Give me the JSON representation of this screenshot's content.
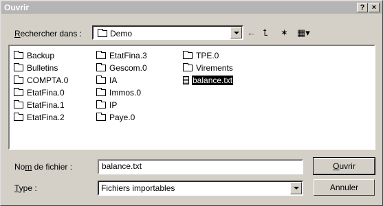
{
  "dialog": {
    "title": "Ouvrir",
    "help_label": "?",
    "close_label": "×"
  },
  "look_in": {
    "label_underlined": "R",
    "label_rest": "echercher dans :",
    "value": "Demo"
  },
  "toolbar": {
    "back_icon": "←",
    "up_icon": "⮤",
    "new_folder_icon": "✶",
    "view_icon": "▦▾"
  },
  "files": [
    {
      "name": "Backup",
      "type": "folder"
    },
    {
      "name": "Bulletins",
      "type": "folder"
    },
    {
      "name": "COMPTA.0",
      "type": "folder"
    },
    {
      "name": "EtatFina.0",
      "type": "folder"
    },
    {
      "name": "EtatFina.1",
      "type": "folder"
    },
    {
      "name": "EtatFina.2",
      "type": "folder"
    },
    {
      "name": "EtatFina.3",
      "type": "folder"
    },
    {
      "name": "Gescom.0",
      "type": "folder"
    },
    {
      "name": "IA",
      "type": "folder"
    },
    {
      "name": "Immos.0",
      "type": "folder"
    },
    {
      "name": "IP",
      "type": "folder"
    },
    {
      "name": "Paye.0",
      "type": "folder"
    },
    {
      "name": "TPE.0",
      "type": "folder"
    },
    {
      "name": "Virements",
      "type": "folder"
    },
    {
      "name": "balance.txt",
      "type": "file",
      "selected": true
    }
  ],
  "filename": {
    "label_pre": "No",
    "label_underlined": "m",
    "label_post": " de fichier :",
    "value": "balance.txt"
  },
  "filetype": {
    "label_underlined": "T",
    "label_rest": "ype :",
    "value": "Fichiers importables"
  },
  "buttons": {
    "open_underlined": "O",
    "open_rest": "uvrir",
    "cancel": "Annuler"
  }
}
